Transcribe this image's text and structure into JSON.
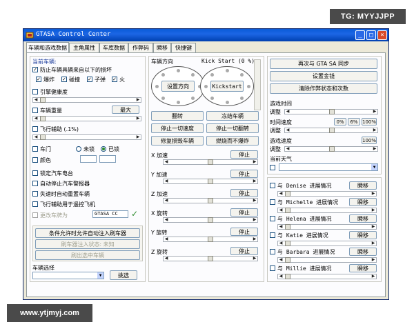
{
  "watermarks": {
    "top": "TG: MYYJJPP",
    "bottom": "www.ytjmyj.com"
  },
  "window": {
    "title": "GTASA Control Center",
    "min": "_",
    "max": "□",
    "close": "×"
  },
  "tabs": [
    "车辆和游戏数据",
    "主角属性",
    "车库数据",
    "作弊码",
    "瞬移",
    "快捷键"
  ],
  "left": {
    "current_vehicle": "当前车辆:",
    "prevent_damage": "防止车辆具辆来自以下的损坏",
    "damage_types": [
      "爆炸",
      "碰撞",
      "子弹",
      "火"
    ],
    "engine_health": "引擎健康度",
    "vehicle_weight": "车辆重量",
    "max_label": "最大",
    "flight_assist": "飞行辅助 (.1%)",
    "door": "车门",
    "unlocked": "未锁",
    "locked": "已锁",
    "color": "颜色",
    "lock_radio": "锁定汽车电台",
    "auto_stop_alarm": "自动停止汽车警报器",
    "auto_reset_vehicle": "失速时自动重置车辆",
    "flight_assist_remote": "飞行辅助用于遥控飞机",
    "change_plate": "更改车牌为",
    "plate_value": "GTASA CC",
    "auto_inject": "条件允许时允许自动注入刷车器",
    "injector_status": "刷车器注入状态: 未知",
    "spawn_selected": "刷出选中车辆",
    "vehicle_select": "车辆选择",
    "pick_button": "挑选"
  },
  "middle": {
    "vehicle_direction": "车辆方向",
    "kick_start": "Kick Start (0 %):",
    "set_direction": "设置方向",
    "kickstart_button": "Kickstart",
    "flip": "翻转",
    "freeze_vehicle": "冻结车辆",
    "stop_all_speed": "停止一切速度",
    "stop_all_rotation": "停止一切翻转",
    "repair_vehicle": "修复损毁车辆",
    "burn_no_explode": "燃烧而不爆炸",
    "axes": [
      "X 加速",
      "Y 加速",
      "Z 加速",
      "X 旋转",
      "Y 旋转",
      "Z 旋转"
    ],
    "stop": "停止"
  },
  "right": {
    "sync": "再次与 GTA SA 同步",
    "set_money": "设置金钱",
    "clear_cheat": "清除作弊状态和次数",
    "game_time": "游戏时间",
    "adjust": "调整",
    "time_speed": "时间速度",
    "time_speed_values": [
      "0%",
      "6%",
      "100%"
    ],
    "game_speed": "游戏速度",
    "game_speed_value": "100%",
    "current_weather": "当前天气",
    "girlfriends": [
      {
        "name": "与 Denise 进展情况"
      },
      {
        "name": "与 Michelle 进展情况"
      },
      {
        "name": "与 Helena 进展情况"
      },
      {
        "name": "与 Katie 进展情况"
      },
      {
        "name": "与 Barbara 进展情况"
      },
      {
        "name": "与 Millie 进展情况"
      }
    ],
    "teleport": "瞬移"
  }
}
